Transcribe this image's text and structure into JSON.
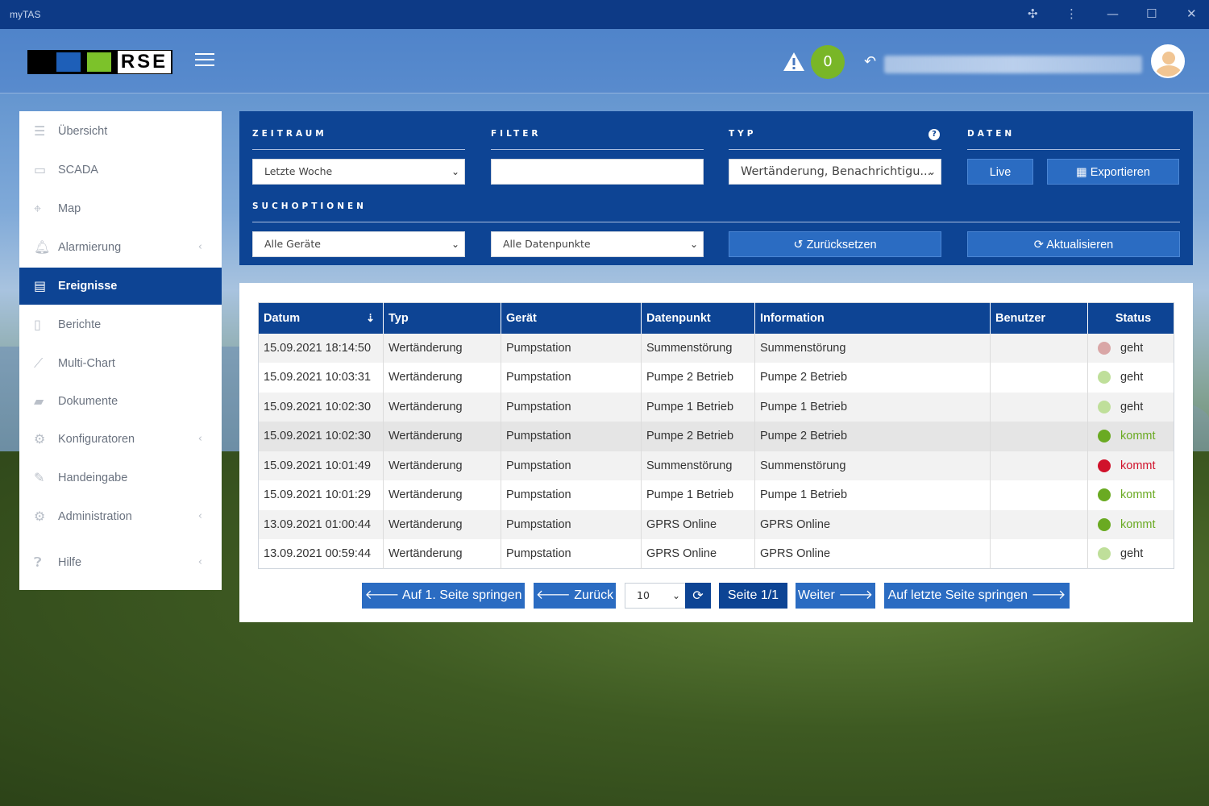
{
  "window": {
    "title": "myTAS"
  },
  "header": {
    "logo_text": "RSE",
    "alarm_count": "0"
  },
  "sidebar": {
    "items": [
      {
        "label": "Übersicht",
        "icon": "list-icon",
        "active": false,
        "has_submenu": false
      },
      {
        "label": "SCADA",
        "icon": "monitor-icon",
        "active": false,
        "has_submenu": false
      },
      {
        "label": "Map",
        "icon": "map-pin-icon",
        "active": false,
        "has_submenu": false
      },
      {
        "label": "Alarmierung",
        "icon": "bell-icon",
        "active": false,
        "has_submenu": true
      },
      {
        "label": "Ereignisse",
        "icon": "list-window-icon",
        "active": true,
        "has_submenu": false
      },
      {
        "label": "Berichte",
        "icon": "document-icon",
        "active": false,
        "has_submenu": false
      },
      {
        "label": "Multi-Chart",
        "icon": "line-chart-icon",
        "active": false,
        "has_submenu": false
      },
      {
        "label": "Dokumente",
        "icon": "folder-icon",
        "active": false,
        "has_submenu": false
      },
      {
        "label": "Konfiguratoren",
        "icon": "gears-icon",
        "active": false,
        "has_submenu": true
      },
      {
        "label": "Handeingabe",
        "icon": "pencil-icon",
        "active": false,
        "has_submenu": false
      },
      {
        "label": "Administration",
        "icon": "gear-icon",
        "active": false,
        "has_submenu": true
      },
      {
        "label": "Hilfe",
        "icon": "question-icon",
        "active": false,
        "has_submenu": true
      }
    ]
  },
  "filters": {
    "zeitraum_label": "ZEITRAUM",
    "zeitraum_value": "Letzte Woche",
    "filter_label": "FILTER",
    "filter_value": "",
    "typ_label": "TYP",
    "typ_value": "Wertänderung, Benachrichtigu...",
    "daten_label": "DATEN",
    "live_label": "Live",
    "export_label": "Exportieren",
    "suchoptionen_label": "SUCHOPTIONEN",
    "geraete_value": "Alle Geräte",
    "datenpunkte_value": "Alle Datenpunkte",
    "reset_label": "Zurücksetzen",
    "refresh_label": "Aktualisieren"
  },
  "table": {
    "columns": [
      "Datum",
      "Typ",
      "Gerät",
      "Datenpunkt",
      "Information",
      "Benutzer",
      "Status"
    ],
    "rows": [
      {
        "datum": "15.09.2021 18:14:50",
        "typ": "Wertänderung",
        "geraet": "Pumpstation",
        "datenpunkt": "Summenstörung",
        "information": "Summenstörung",
        "benutzer": "",
        "status": "geht",
        "status_color": "#d9a6a6",
        "status_text_color": "#333333"
      },
      {
        "datum": "15.09.2021 10:03:31",
        "typ": "Wertänderung",
        "geraet": "Pumpstation",
        "datenpunkt": "Pumpe 2 Betrieb",
        "information": "Pumpe 2 Betrieb",
        "benutzer": "",
        "status": "geht",
        "status_color": "#bfdf9a",
        "status_text_color": "#333333"
      },
      {
        "datum": "15.09.2021 10:02:30",
        "typ": "Wertänderung",
        "geraet": "Pumpstation",
        "datenpunkt": "Pumpe 1 Betrieb",
        "information": "Pumpe 1 Betrieb",
        "benutzer": "",
        "status": "geht",
        "status_color": "#bfdf9a",
        "status_text_color": "#333333"
      },
      {
        "datum": "15.09.2021 10:02:30",
        "typ": "Wertänderung",
        "geraet": "Pumpstation",
        "datenpunkt": "Pumpe 2 Betrieb",
        "information": "Pumpe 2 Betrieb",
        "benutzer": "",
        "status": "kommt",
        "status_color": "#6aaa22",
        "status_text_color": "#6aaa22"
      },
      {
        "datum": "15.09.2021 10:01:49",
        "typ": "Wertänderung",
        "geraet": "Pumpstation",
        "datenpunkt": "Summenstörung",
        "information": "Summenstörung",
        "benutzer": "",
        "status": "kommt",
        "status_color": "#d0122b",
        "status_text_color": "#d0122b"
      },
      {
        "datum": "15.09.2021 10:01:29",
        "typ": "Wertänderung",
        "geraet": "Pumpstation",
        "datenpunkt": "Pumpe 1 Betrieb",
        "information": "Pumpe 1 Betrieb",
        "benutzer": "",
        "status": "kommt",
        "status_color": "#6aaa22",
        "status_text_color": "#6aaa22"
      },
      {
        "datum": "13.09.2021 01:00:44",
        "typ": "Wertänderung",
        "geraet": "Pumpstation",
        "datenpunkt": "GPRS Online",
        "information": "GPRS Online",
        "benutzer": "",
        "status": "kommt",
        "status_color": "#6aaa22",
        "status_text_color": "#6aaa22"
      },
      {
        "datum": "13.09.2021 00:59:44",
        "typ": "Wertänderung",
        "geraet": "Pumpstation",
        "datenpunkt": "GPRS Online",
        "information": "GPRS Online",
        "benutzer": "",
        "status": "geht",
        "status_color": "#bfdf9a",
        "status_text_color": "#333333"
      }
    ]
  },
  "pagination": {
    "first_label": "Auf 1. Seite springen",
    "prev_label": "Zurück",
    "page_size": "10",
    "page_info": "Seite 1/1",
    "next_label": "Weiter",
    "last_label": "Auf letzte Seite springen"
  },
  "colors": {
    "primary": "#0d4494",
    "button": "#2b6cc2",
    "alarm_badge": "#79b627"
  }
}
